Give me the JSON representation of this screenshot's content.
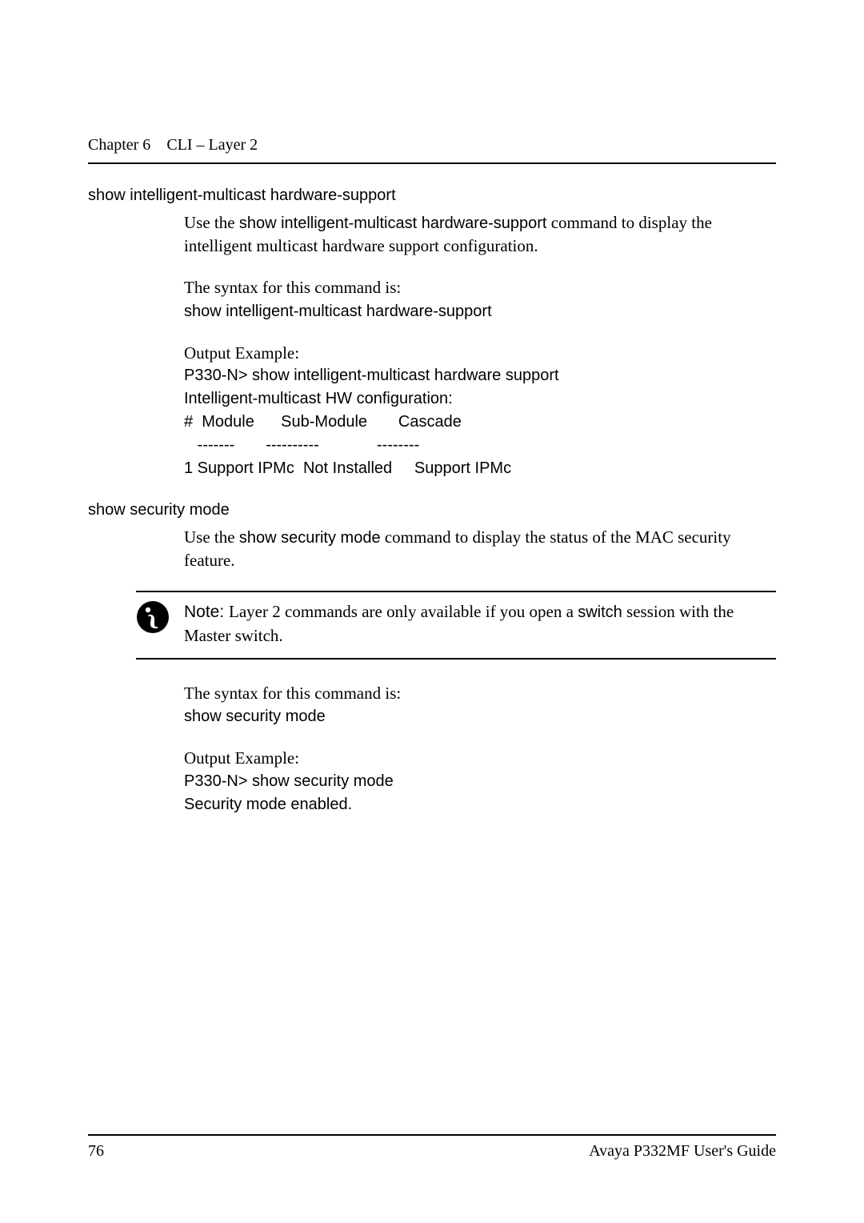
{
  "header": {
    "chapter": "Chapter 6",
    "title": "CLI – Layer 2"
  },
  "section1": {
    "heading": "show intelligent-multicast hardware-support",
    "intro_pre": "Use the ",
    "intro_cmd": "show intelligent-multicast hardware-support",
    "intro_post": " command to display the intelligent multicast hardware support configuration.",
    "syntax_label": "The syntax for this command is:",
    "syntax_cmd": "show intelligent-multicast hardware-support",
    "output_label": "Output Example:",
    "output_text": "P330-N> show intelligent-multicast hardware support\nIntelligent-multicast HW configuration:\n#  Module      Sub-Module       Cascade\n   -------       ----------             --------\n1 Support IPMc  Not Installed     Support IPMc"
  },
  "section2": {
    "heading": "show security mode",
    "intro_pre": "Use the ",
    "intro_cmd": "show security mode",
    "intro_post": " command to display the status of the MAC security feature.",
    "note_label": "Note: ",
    "note_body_pre": "Layer 2 commands are only available if you open a ",
    "note_cmd": "switch",
    "note_body_post": " session with the Master switch.",
    "syntax_label": "The syntax for this command is:",
    "syntax_cmd": "show security mode",
    "output_label": "Output Example:",
    "output_text": "P330-N> show security mode\nSecurity mode enabled."
  },
  "footer": {
    "page": "76",
    "doc": "Avaya P332MF User's Guide"
  }
}
